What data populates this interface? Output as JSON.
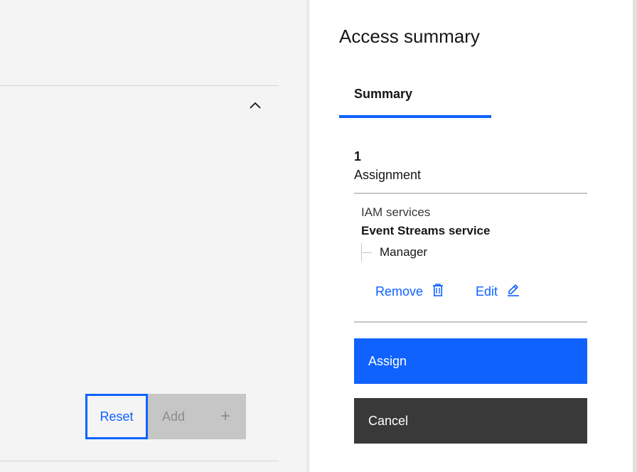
{
  "form": {
    "reset_label": "Reset",
    "add_label": "Add",
    "add_icon": "+"
  },
  "panel": {
    "title": "Access summary",
    "tabs": [
      {
        "label": "Summary",
        "selected": true
      }
    ],
    "assignment_count": "1",
    "assignment_label": "Assignment",
    "assignments": [
      {
        "category": "IAM services",
        "service": "Event Streams service",
        "role": "Manager",
        "remove_label": "Remove",
        "edit_label": "Edit"
      }
    ],
    "assign_label": "Assign",
    "cancel_label": "Cancel"
  },
  "colors": {
    "accent": "#0f62fe",
    "primary_button": "#0f62fe",
    "secondary_button": "#393939",
    "disabled_button": "#c6c6c6"
  },
  "icons": {
    "collapse": "chevron-up-icon",
    "remove": "trash-can-icon",
    "edit": "pencil-icon",
    "add": "plus-icon"
  }
}
